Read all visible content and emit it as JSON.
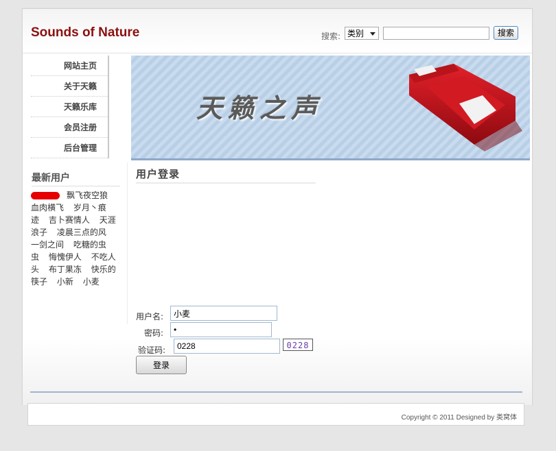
{
  "header": {
    "site_title": "Sounds of Nature",
    "search_label": "搜索:",
    "search_category": "类别",
    "search_value": "",
    "search_button": "搜索"
  },
  "nav": {
    "items": [
      {
        "label": "网站主页"
      },
      {
        "label": "关于天籁"
      },
      {
        "label": "天籁乐库"
      },
      {
        "label": "会员注册"
      },
      {
        "label": "后台管理"
      }
    ]
  },
  "banner": {
    "text": "天籁之声"
  },
  "latest_users": {
    "title": "最新用户",
    "users": [
      "飘飞夜空狼",
      "血肉横飞",
      "岁月丶痕迹",
      "吉卜赛情人",
      "天涯浪子",
      "凌晨三点的风",
      "一剑之间",
      "吃糖的虫虫",
      "悔愧伊人",
      "不吃人头",
      "布丁果冻",
      "快乐的筷子",
      "小新",
      "小麦"
    ]
  },
  "login": {
    "title": "用户登录",
    "username_label": "用户名:",
    "username_value": "小麦",
    "password_label": "密码:",
    "password_value": "•",
    "captcha_label": "验证码:",
    "captcha_value": "0228",
    "captcha_image_text": "0228",
    "submit_label": "登录"
  },
  "footer": {
    "copyright": "Copyright © 2011 Designed by 类窝体"
  },
  "colors": {
    "title_red": "#8b1010",
    "banner_blue": "#c9dbee",
    "sofa_red": "#c8141c",
    "footer_rule": "#9fb3d1"
  }
}
